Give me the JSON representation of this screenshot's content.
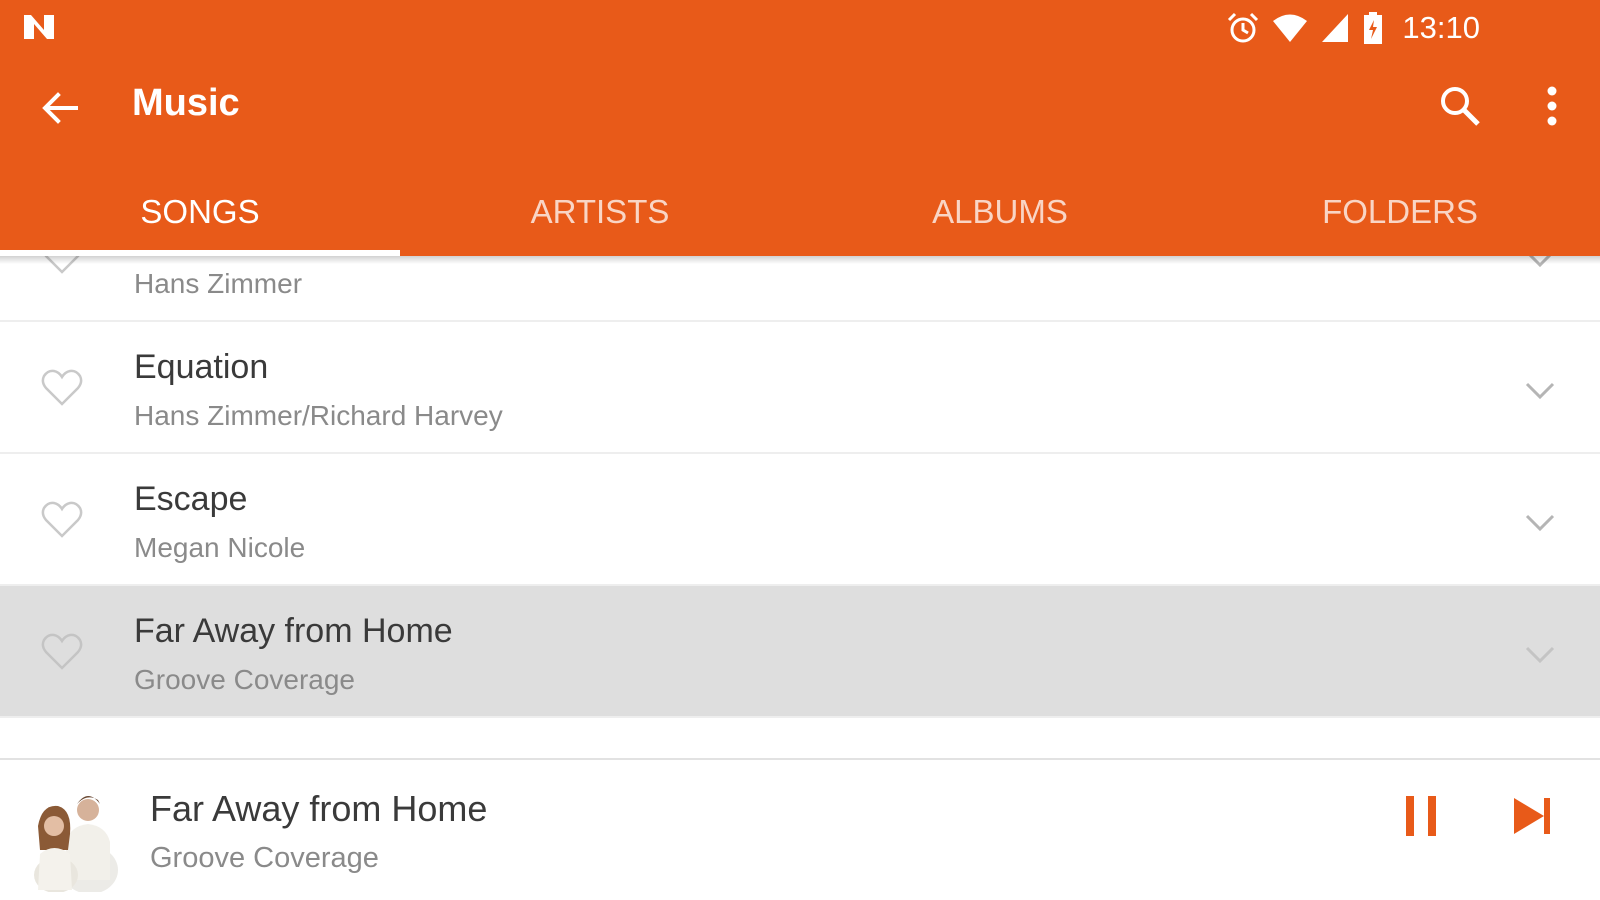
{
  "colors": {
    "accent": "#e85a19",
    "selected_row": "#dedede",
    "title_text": "#3a3a3a",
    "subtitle_text": "#8a8a8a"
  },
  "status_bar": {
    "time": "13:10",
    "icons": [
      "notification-n-icon",
      "alarm-icon",
      "wifi-icon",
      "signal-icon",
      "battery-charging-icon"
    ]
  },
  "toolbar": {
    "title": "Music",
    "icons": [
      "back-arrow-icon",
      "search-icon",
      "more-vert-icon"
    ]
  },
  "tabs": [
    {
      "label": "SONGS",
      "active": true
    },
    {
      "label": "ARTISTS",
      "active": false
    },
    {
      "label": "ALBUMS",
      "active": false
    },
    {
      "label": "FOLDERS",
      "active": false
    }
  ],
  "songs": [
    {
      "title": "",
      "artist": "Hans Zimmer"
    },
    {
      "title": "Equation",
      "artist": "Hans Zimmer/Richard Harvey"
    },
    {
      "title": "Escape",
      "artist": "Megan Nicole"
    },
    {
      "title": "Far Away from Home",
      "artist": "Groove Coverage",
      "selected": true
    }
  ],
  "now_playing": {
    "title": "Far Away from Home",
    "artist": "Groove Coverage",
    "state": "playing",
    "icons": [
      "pause-icon",
      "skip-next-icon"
    ]
  }
}
